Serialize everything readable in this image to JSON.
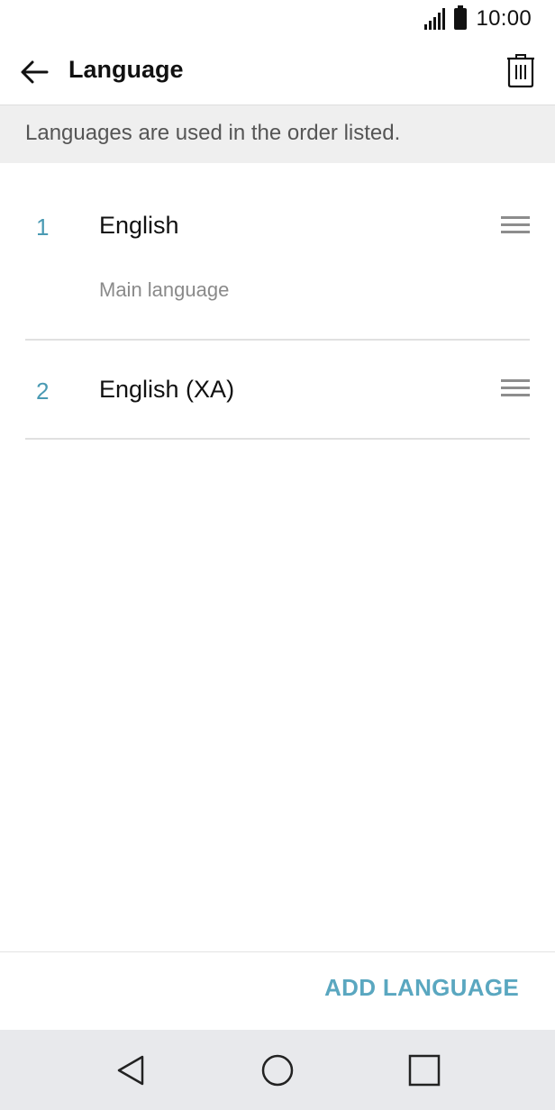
{
  "status_bar": {
    "time": "10:00",
    "icons": [
      "signal-icon",
      "battery-icon"
    ]
  },
  "app_bar": {
    "title": "Language",
    "icons": [
      "back-arrow-icon",
      "trash-icon"
    ]
  },
  "info_banner": {
    "text": "Languages are used in the order listed."
  },
  "languages": [
    {
      "number": "1",
      "name": "English",
      "subtitle": "Main language"
    },
    {
      "number": "2",
      "name": "English (XA)"
    }
  ],
  "actions": {
    "add_language": "ADD LANGUAGE"
  },
  "nav_bar": {
    "icons": [
      "nav-back-icon",
      "nav-home-icon",
      "nav-recent-icon"
    ]
  },
  "colors": {
    "accent": "#5aa7c0",
    "number": "#4a9ab3",
    "banner_bg": "#efefef",
    "nav_bg": "#e8e9ec"
  }
}
